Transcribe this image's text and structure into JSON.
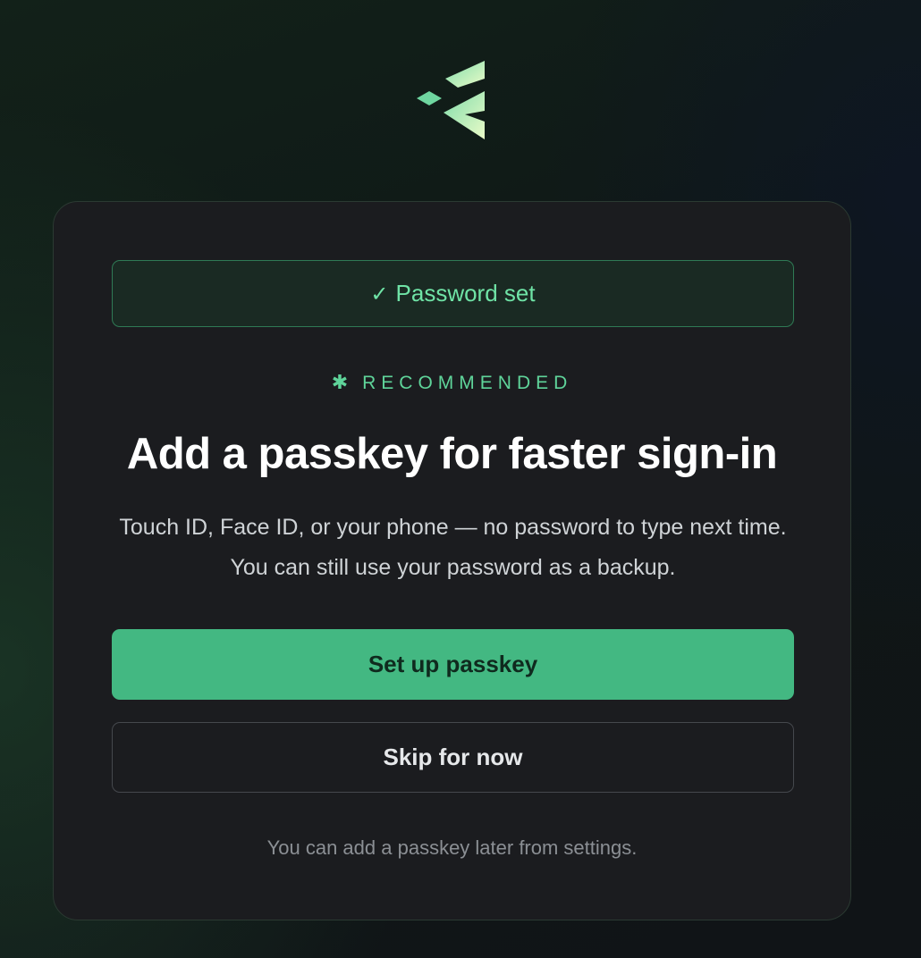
{
  "brand": {
    "logo_icon": "app-logo-chevron-icon",
    "colors": {
      "logo_light": "#e9f9c9",
      "logo_mid": "#9be3b4",
      "accent": "#43b882",
      "accent_text": "#6fe3a6",
      "background": "#101417",
      "card": "#1b1c1f"
    }
  },
  "status": {
    "icon": "check-icon",
    "check_glyph": "✓",
    "label": "Password set"
  },
  "recommended": {
    "icon": "asterisk-icon",
    "star_glyph": "✱",
    "label": "RECOMMENDED"
  },
  "title": "Add a passkey for faster sign-in",
  "description": "Touch ID, Face ID, or your phone — no password to type next time. You can still use your password as a backup.",
  "actions": {
    "primary_label": "Set up passkey",
    "secondary_label": "Skip for now"
  },
  "footnote": "You can add a passkey later from settings."
}
